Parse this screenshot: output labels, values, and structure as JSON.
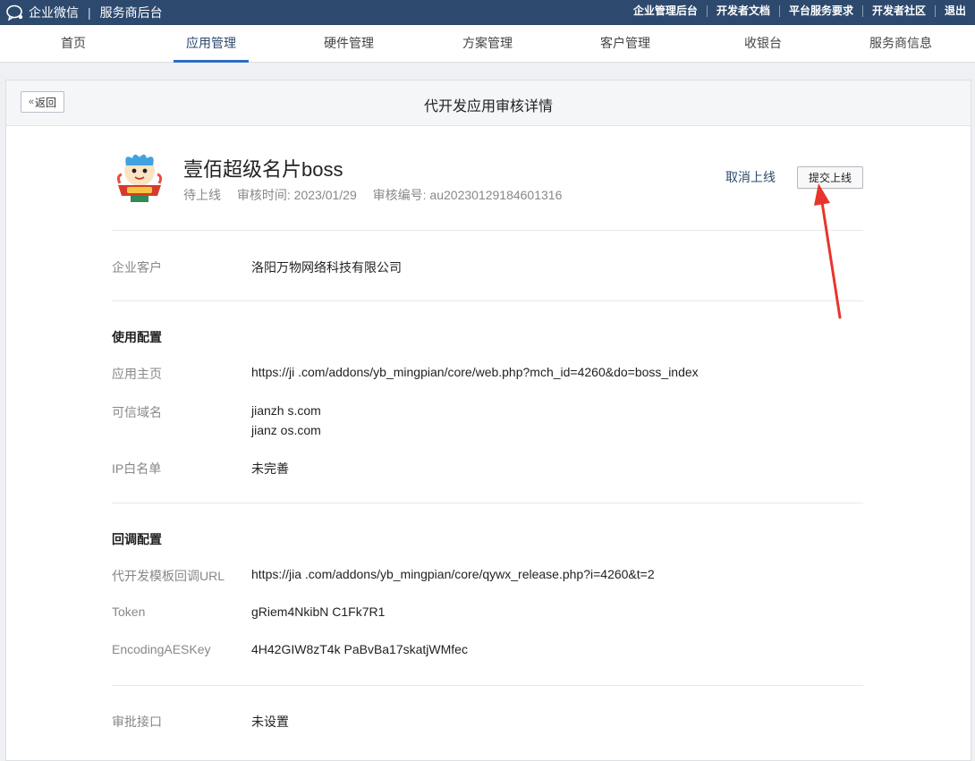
{
  "topbar": {
    "brand": "企业微信",
    "subtitle": "服务商后台",
    "links": [
      "企业管理后台",
      "开发者文档",
      "平台服务要求",
      "开发者社区",
      "退出"
    ]
  },
  "nav": {
    "items": [
      "首页",
      "应用管理",
      "硬件管理",
      "方案管理",
      "客户管理",
      "收银台",
      "服务商信息"
    ],
    "active": "应用管理"
  },
  "card": {
    "back_label": "返回",
    "title": "代开发应用审核详情"
  },
  "app": {
    "name": "壹佰超级名片boss",
    "status": "待上线",
    "review_time": "审核时间: 2023/01/29",
    "review_no": "审核编号: au20230129184601316",
    "cancel_label": "取消上线",
    "submit_label": "提交上线"
  },
  "customer": {
    "label": "企业客户",
    "value": "洛阳万物网络科技有限公司"
  },
  "usage": {
    "title": "使用配置",
    "homepage_label": "应用主页",
    "homepage_value": "https://ji                        .com/addons/yb_mingpian/core/web.php?mch_id=4260&do=boss_index",
    "domain_label": "可信域名",
    "domain_values": [
      "jianzh               s.com",
      "jianz               os.com"
    ],
    "ip_label": "IP白名单",
    "ip_value": "未完善"
  },
  "callback": {
    "title": "回调配置",
    "url_label": "代开发模板回调URL",
    "url_value": "https://jia                        .com/addons/yb_mingpian/core/qywx_release.php?i=4260&t=2",
    "token_label": "Token",
    "token_value": "gRiem4NkibN                    C1Fk7R1",
    "aes_label": "EncodingAESKey",
    "aes_value": "4H42GIW8zT4k                    PaBvBa17skatjWMfec"
  },
  "approval": {
    "label": "审批接口",
    "value": "未设置"
  },
  "colors": {
    "topbar": "#2d4a6e",
    "active_underline": "#2d6cc0",
    "arrow": "#e8352b"
  }
}
